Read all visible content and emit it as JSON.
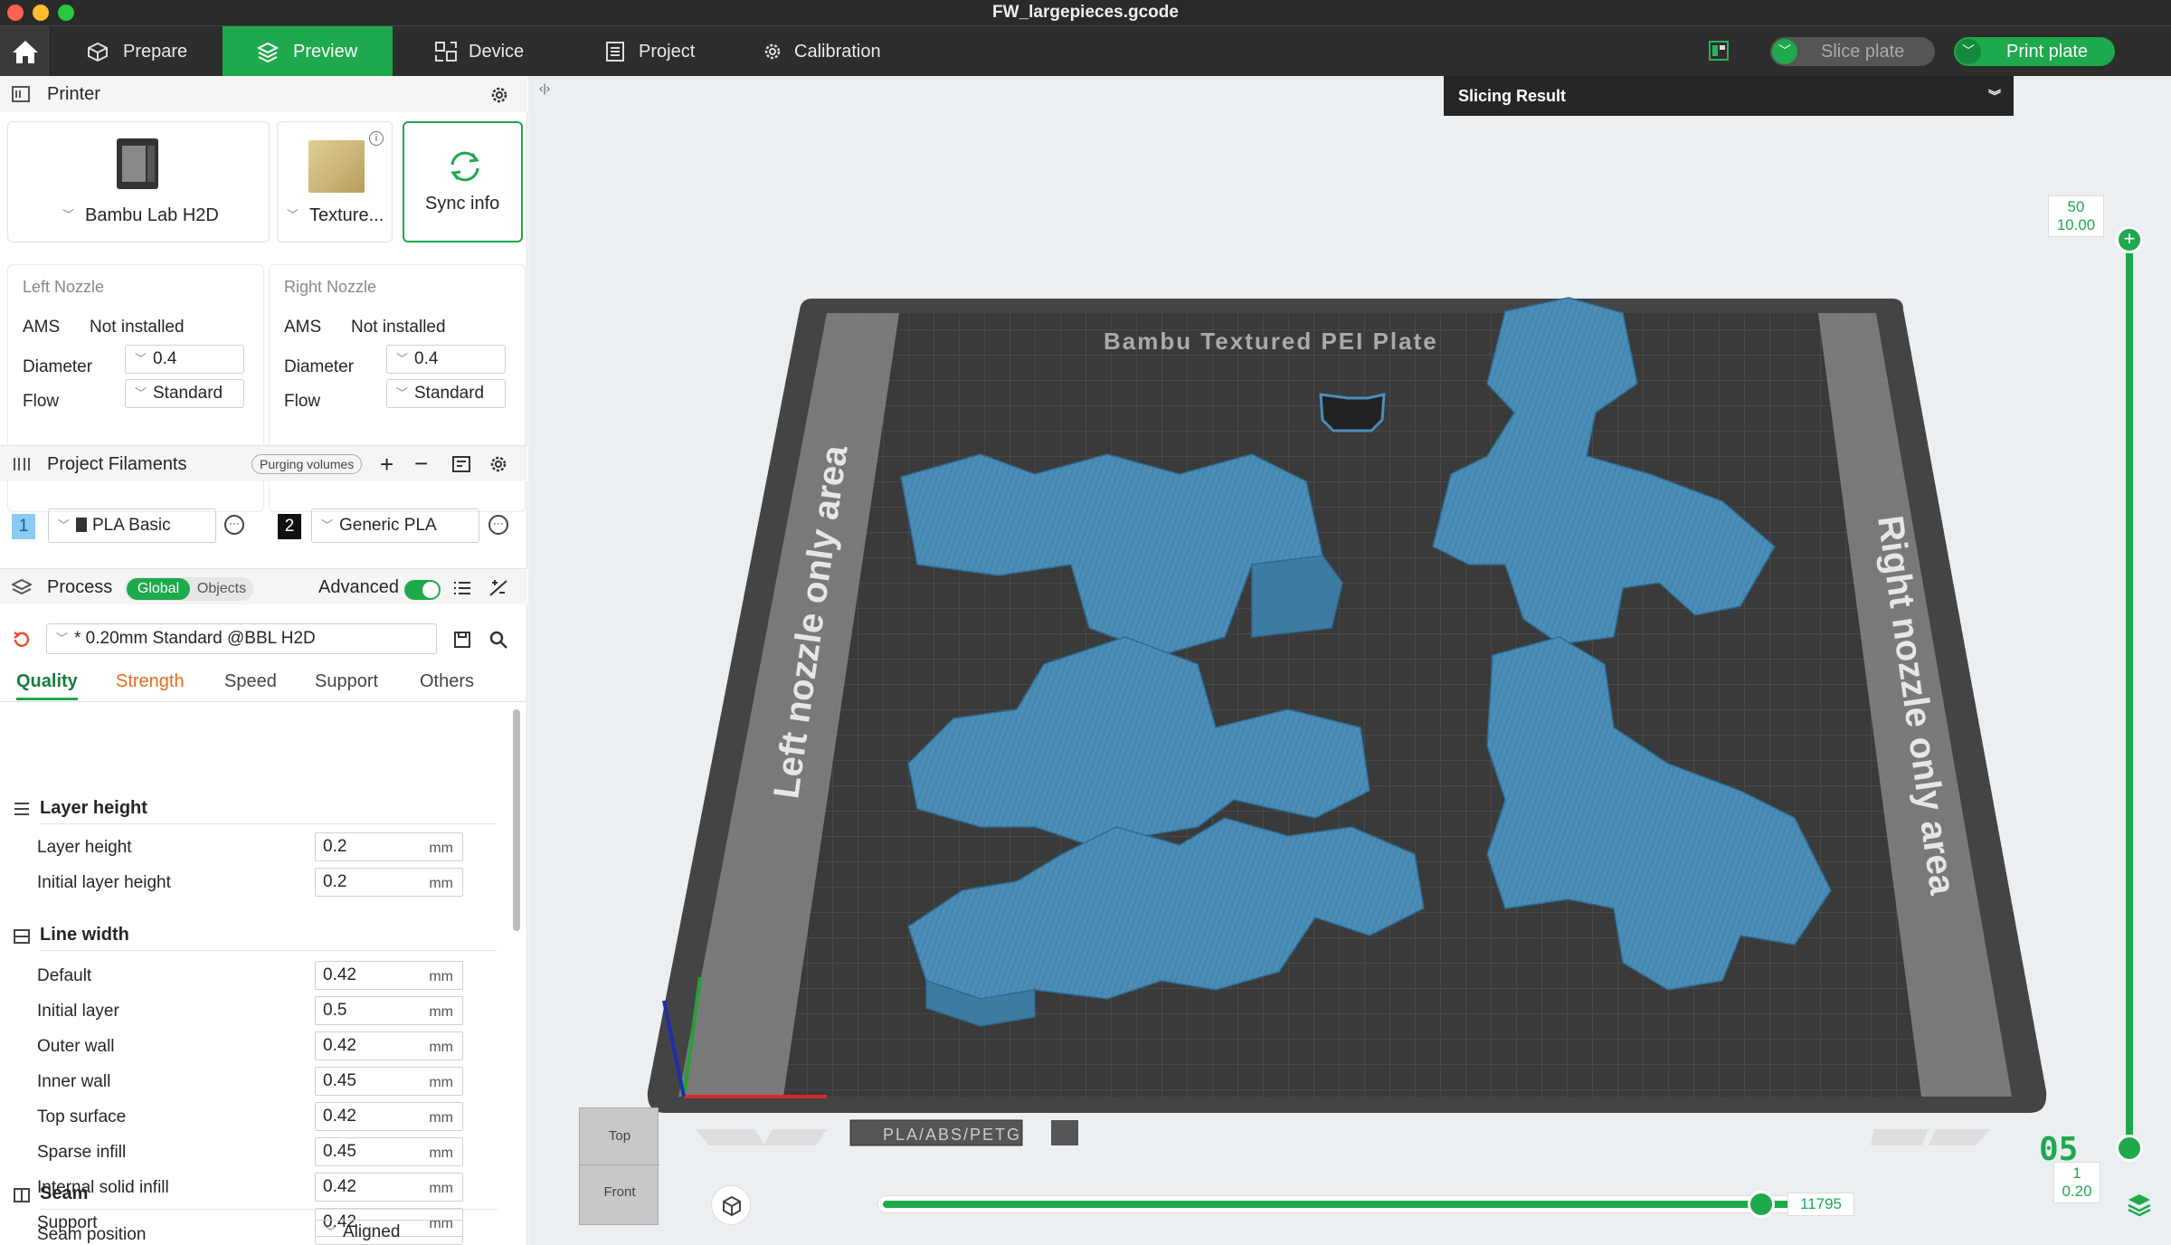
{
  "window": {
    "title": "FW_largepieces.gcode"
  },
  "toolbar": {
    "tabs": [
      {
        "label": "Prepare",
        "icon": "cube-icon"
      },
      {
        "label": "Preview",
        "icon": "layers-icon"
      },
      {
        "label": "Device",
        "icon": "device-icon"
      },
      {
        "label": "Project",
        "icon": "document-icon"
      },
      {
        "label": "Calibration",
        "icon": "gear-icon"
      }
    ],
    "slice_label": "Slice plate",
    "print_label": "Print plate"
  },
  "printer": {
    "section_title": "Printer",
    "printer_name": "Bambu Lab H2D",
    "plate_name": "Texture...",
    "sync_label": "Sync info"
  },
  "nozzles": {
    "left": {
      "title": "Left Nozzle",
      "ams_label": "AMS",
      "ams_value": "Not installed",
      "diameter_label": "Diameter",
      "diameter": "0.4",
      "flow_label": "Flow",
      "flow": "Standard"
    },
    "right": {
      "title": "Right Nozzle",
      "ams_label": "AMS",
      "ams_value": "Not installed",
      "diameter_label": "Diameter",
      "diameter": "0.4",
      "flow_label": "Flow",
      "flow": "Standard"
    }
  },
  "filaments": {
    "section_title": "Project Filaments",
    "purging_label": "Purging volumes",
    "items": [
      {
        "index": "1",
        "name": "PLA Basic",
        "color": "#4d9fe0"
      },
      {
        "index": "2",
        "name": "Generic PLA",
        "color": "#111111"
      }
    ]
  },
  "process": {
    "section_title": "Process",
    "global_label": "Global",
    "objects_label": "Objects",
    "advanced_label": "Advanced",
    "profile": "* 0.20mm Standard @BBL H2D",
    "tabs": [
      "Quality",
      "Strength",
      "Speed",
      "Support",
      "Others"
    ]
  },
  "settings": {
    "layer_height_title": "Layer height",
    "layer_height": [
      {
        "label": "Layer height",
        "value": "0.2",
        "unit": "mm"
      },
      {
        "label": "Initial layer height",
        "value": "0.2",
        "unit": "mm"
      }
    ],
    "line_width_title": "Line width",
    "line_width": [
      {
        "label": "Default",
        "value": "0.42",
        "unit": "mm"
      },
      {
        "label": "Initial layer",
        "value": "0.5",
        "unit": "mm"
      },
      {
        "label": "Outer wall",
        "value": "0.42",
        "unit": "mm"
      },
      {
        "label": "Inner wall",
        "value": "0.45",
        "unit": "mm"
      },
      {
        "label": "Top surface",
        "value": "0.42",
        "unit": "mm"
      },
      {
        "label": "Sparse infill",
        "value": "0.45",
        "unit": "mm"
      },
      {
        "label": "Internal solid infill",
        "value": "0.42",
        "unit": "mm"
      },
      {
        "label": "Support",
        "value": "0.42",
        "unit": "mm"
      }
    ],
    "seam_title": "Seam",
    "seam_position_label": "Seam position",
    "seam_position": "Aligned"
  },
  "viewport": {
    "slicing_result_label": "Slicing Result",
    "plate_label": "Bambu Textured PEI Plate",
    "left_area_label": "Left nozzle only area",
    "right_area_label": "Right nozzle only area",
    "plate_footer_label": "PLA/ABS/PETG",
    "layer_top": {
      "index": "50",
      "height": "10.00"
    },
    "layer_bottom": {
      "index": "1",
      "height": "0.20"
    },
    "layer_display": "05",
    "move_count": "11795",
    "view_top": "Top",
    "view_front": "Front",
    "model_color": "#4a8db7"
  }
}
